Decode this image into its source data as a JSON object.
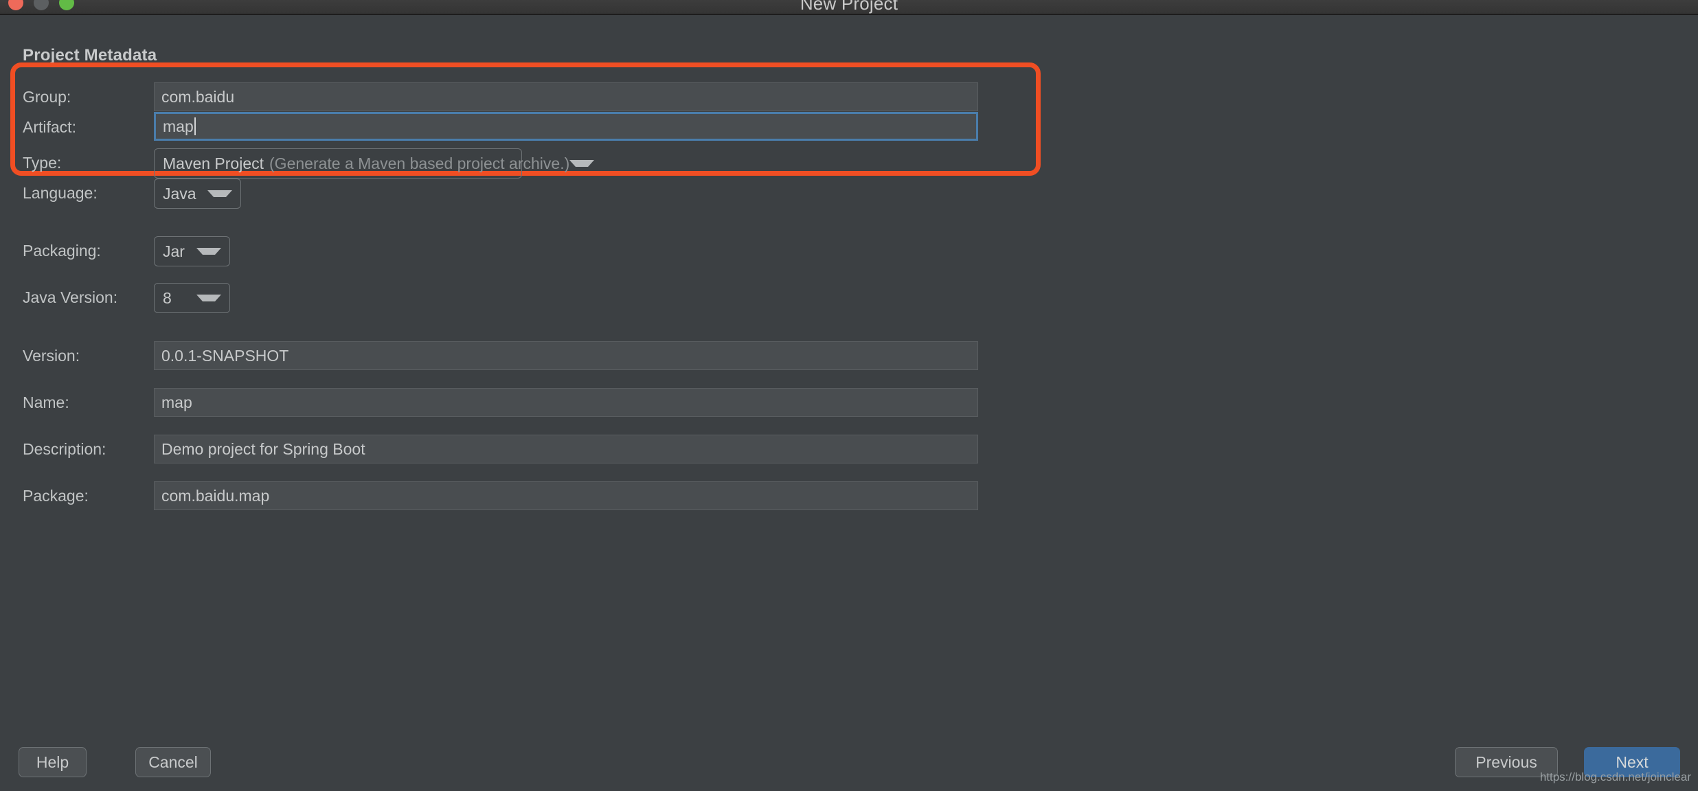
{
  "window": {
    "title": "New Project",
    "traffic_lights": [
      "close-light",
      "minimize-light",
      "zoom-light"
    ]
  },
  "form": {
    "section_title": "Project Metadata",
    "fields": [
      {
        "label": "Group:",
        "value": "com.baidu",
        "kind": "text"
      },
      {
        "label": "Artifact:",
        "value": "map",
        "kind": "text-focused"
      },
      {
        "label": "Type:",
        "value": "Maven Project",
        "hint": "(Generate a Maven based project archive.)",
        "kind": "combo"
      },
      {
        "label": "Language:",
        "value": "Java",
        "kind": "combo"
      },
      {
        "label": "Packaging:",
        "value": "Jar",
        "kind": "combo"
      },
      {
        "label": "Java Version:",
        "value": "8",
        "kind": "combo"
      },
      {
        "label": "Version:",
        "value": "0.0.1-SNAPSHOT",
        "kind": "text"
      },
      {
        "label": "Name:",
        "value": "map",
        "kind": "text"
      },
      {
        "label": "Description:",
        "value": "Demo project for Spring Boot",
        "kind": "text"
      },
      {
        "label": "Package:",
        "value": "com.baidu.map",
        "kind": "text"
      }
    ]
  },
  "footer": {
    "help_label": "Help",
    "cancel_label": "Cancel",
    "previous_label": "Previous",
    "next_label": "Next"
  },
  "annotation": {
    "color": "#f04e23"
  },
  "watermark": {
    "text": "https://blog.csdn.net/joinclear"
  },
  "colors": {
    "dialog_background": "#3c4043",
    "titlebar": "#383838",
    "field_background": "#494d50",
    "focus_blue": "#4a7dab",
    "primary_button": "#3b6a9c",
    "annotation_red": "#f04e23"
  }
}
